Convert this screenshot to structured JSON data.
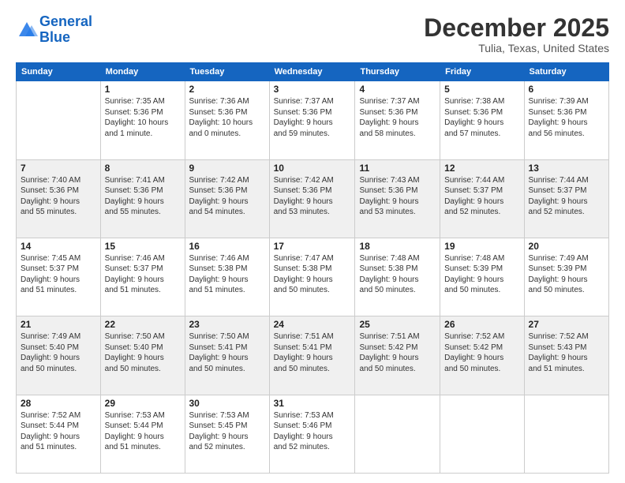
{
  "header": {
    "logo_line1": "General",
    "logo_line2": "Blue",
    "month": "December 2025",
    "location": "Tulia, Texas, United States"
  },
  "weekdays": [
    "Sunday",
    "Monday",
    "Tuesday",
    "Wednesday",
    "Thursday",
    "Friday",
    "Saturday"
  ],
  "weeks": [
    [
      {
        "day": "",
        "info": ""
      },
      {
        "day": "1",
        "info": "Sunrise: 7:35 AM\nSunset: 5:36 PM\nDaylight: 10 hours\nand 1 minute."
      },
      {
        "day": "2",
        "info": "Sunrise: 7:36 AM\nSunset: 5:36 PM\nDaylight: 10 hours\nand 0 minutes."
      },
      {
        "day": "3",
        "info": "Sunrise: 7:37 AM\nSunset: 5:36 PM\nDaylight: 9 hours\nand 59 minutes."
      },
      {
        "day": "4",
        "info": "Sunrise: 7:37 AM\nSunset: 5:36 PM\nDaylight: 9 hours\nand 58 minutes."
      },
      {
        "day": "5",
        "info": "Sunrise: 7:38 AM\nSunset: 5:36 PM\nDaylight: 9 hours\nand 57 minutes."
      },
      {
        "day": "6",
        "info": "Sunrise: 7:39 AM\nSunset: 5:36 PM\nDaylight: 9 hours\nand 56 minutes."
      }
    ],
    [
      {
        "day": "7",
        "info": "Sunrise: 7:40 AM\nSunset: 5:36 PM\nDaylight: 9 hours\nand 55 minutes."
      },
      {
        "day": "8",
        "info": "Sunrise: 7:41 AM\nSunset: 5:36 PM\nDaylight: 9 hours\nand 55 minutes."
      },
      {
        "day": "9",
        "info": "Sunrise: 7:42 AM\nSunset: 5:36 PM\nDaylight: 9 hours\nand 54 minutes."
      },
      {
        "day": "10",
        "info": "Sunrise: 7:42 AM\nSunset: 5:36 PM\nDaylight: 9 hours\nand 53 minutes."
      },
      {
        "day": "11",
        "info": "Sunrise: 7:43 AM\nSunset: 5:36 PM\nDaylight: 9 hours\nand 53 minutes."
      },
      {
        "day": "12",
        "info": "Sunrise: 7:44 AM\nSunset: 5:37 PM\nDaylight: 9 hours\nand 52 minutes."
      },
      {
        "day": "13",
        "info": "Sunrise: 7:44 AM\nSunset: 5:37 PM\nDaylight: 9 hours\nand 52 minutes."
      }
    ],
    [
      {
        "day": "14",
        "info": "Sunrise: 7:45 AM\nSunset: 5:37 PM\nDaylight: 9 hours\nand 51 minutes."
      },
      {
        "day": "15",
        "info": "Sunrise: 7:46 AM\nSunset: 5:37 PM\nDaylight: 9 hours\nand 51 minutes."
      },
      {
        "day": "16",
        "info": "Sunrise: 7:46 AM\nSunset: 5:38 PM\nDaylight: 9 hours\nand 51 minutes."
      },
      {
        "day": "17",
        "info": "Sunrise: 7:47 AM\nSunset: 5:38 PM\nDaylight: 9 hours\nand 50 minutes."
      },
      {
        "day": "18",
        "info": "Sunrise: 7:48 AM\nSunset: 5:38 PM\nDaylight: 9 hours\nand 50 minutes."
      },
      {
        "day": "19",
        "info": "Sunrise: 7:48 AM\nSunset: 5:39 PM\nDaylight: 9 hours\nand 50 minutes."
      },
      {
        "day": "20",
        "info": "Sunrise: 7:49 AM\nSunset: 5:39 PM\nDaylight: 9 hours\nand 50 minutes."
      }
    ],
    [
      {
        "day": "21",
        "info": "Sunrise: 7:49 AM\nSunset: 5:40 PM\nDaylight: 9 hours\nand 50 minutes."
      },
      {
        "day": "22",
        "info": "Sunrise: 7:50 AM\nSunset: 5:40 PM\nDaylight: 9 hours\nand 50 minutes."
      },
      {
        "day": "23",
        "info": "Sunrise: 7:50 AM\nSunset: 5:41 PM\nDaylight: 9 hours\nand 50 minutes."
      },
      {
        "day": "24",
        "info": "Sunrise: 7:51 AM\nSunset: 5:41 PM\nDaylight: 9 hours\nand 50 minutes."
      },
      {
        "day": "25",
        "info": "Sunrise: 7:51 AM\nSunset: 5:42 PM\nDaylight: 9 hours\nand 50 minutes."
      },
      {
        "day": "26",
        "info": "Sunrise: 7:52 AM\nSunset: 5:42 PM\nDaylight: 9 hours\nand 50 minutes."
      },
      {
        "day": "27",
        "info": "Sunrise: 7:52 AM\nSunset: 5:43 PM\nDaylight: 9 hours\nand 51 minutes."
      }
    ],
    [
      {
        "day": "28",
        "info": "Sunrise: 7:52 AM\nSunset: 5:44 PM\nDaylight: 9 hours\nand 51 minutes."
      },
      {
        "day": "29",
        "info": "Sunrise: 7:53 AM\nSunset: 5:44 PM\nDaylight: 9 hours\nand 51 minutes."
      },
      {
        "day": "30",
        "info": "Sunrise: 7:53 AM\nSunset: 5:45 PM\nDaylight: 9 hours\nand 52 minutes."
      },
      {
        "day": "31",
        "info": "Sunrise: 7:53 AM\nSunset: 5:46 PM\nDaylight: 9 hours\nand 52 minutes."
      },
      {
        "day": "",
        "info": ""
      },
      {
        "day": "",
        "info": ""
      },
      {
        "day": "",
        "info": ""
      }
    ]
  ]
}
